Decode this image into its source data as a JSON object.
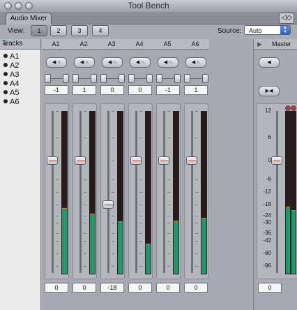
{
  "window": {
    "title": "Tool Bench"
  },
  "tab": {
    "label": "Audio Mixer"
  },
  "view": {
    "label": "View:",
    "buttons": [
      "1",
      "2",
      "3",
      "4"
    ],
    "selected": 0
  },
  "source": {
    "label": "Source:",
    "value": "Auto"
  },
  "tracks_panel": {
    "header": "Tracks",
    "items": [
      "A1",
      "A2",
      "A3",
      "A4",
      "A5",
      "A6"
    ]
  },
  "strips": [
    {
      "name": "A1",
      "pan": "-1",
      "volume": "0",
      "fader_db": 0,
      "meter_db": -20
    },
    {
      "name": "A2",
      "pan": "1",
      "volume": "0",
      "fader_db": 0,
      "meter_db": -23
    },
    {
      "name": "A3",
      "pan": "0",
      "volume": "-18",
      "fader_db": -18,
      "meter_db": -29
    },
    {
      "name": "A4",
      "pan": "0",
      "volume": "0",
      "fader_db": 0,
      "meter_db": -46
    },
    {
      "name": "A5",
      "pan": "-1",
      "volume": "0",
      "fader_db": 0,
      "meter_db": -28
    },
    {
      "name": "A6",
      "pan": "1",
      "volume": "0",
      "fader_db": 0,
      "meter_db": -26
    }
  ],
  "master": {
    "label": "Master",
    "volume": "0",
    "fader_db": 0,
    "meter_left_db": -19,
    "meter_right_db": -21,
    "scale": [
      "12",
      "6",
      "0",
      "-6",
      "-12",
      "-18",
      "-24",
      "-30",
      "-36",
      "-42",
      "-60",
      "-96"
    ]
  },
  "colors": {
    "meter_fill": "#1d9a6a",
    "meter_peak": "#d08a20",
    "meter_bg": "#2a1a1a"
  }
}
